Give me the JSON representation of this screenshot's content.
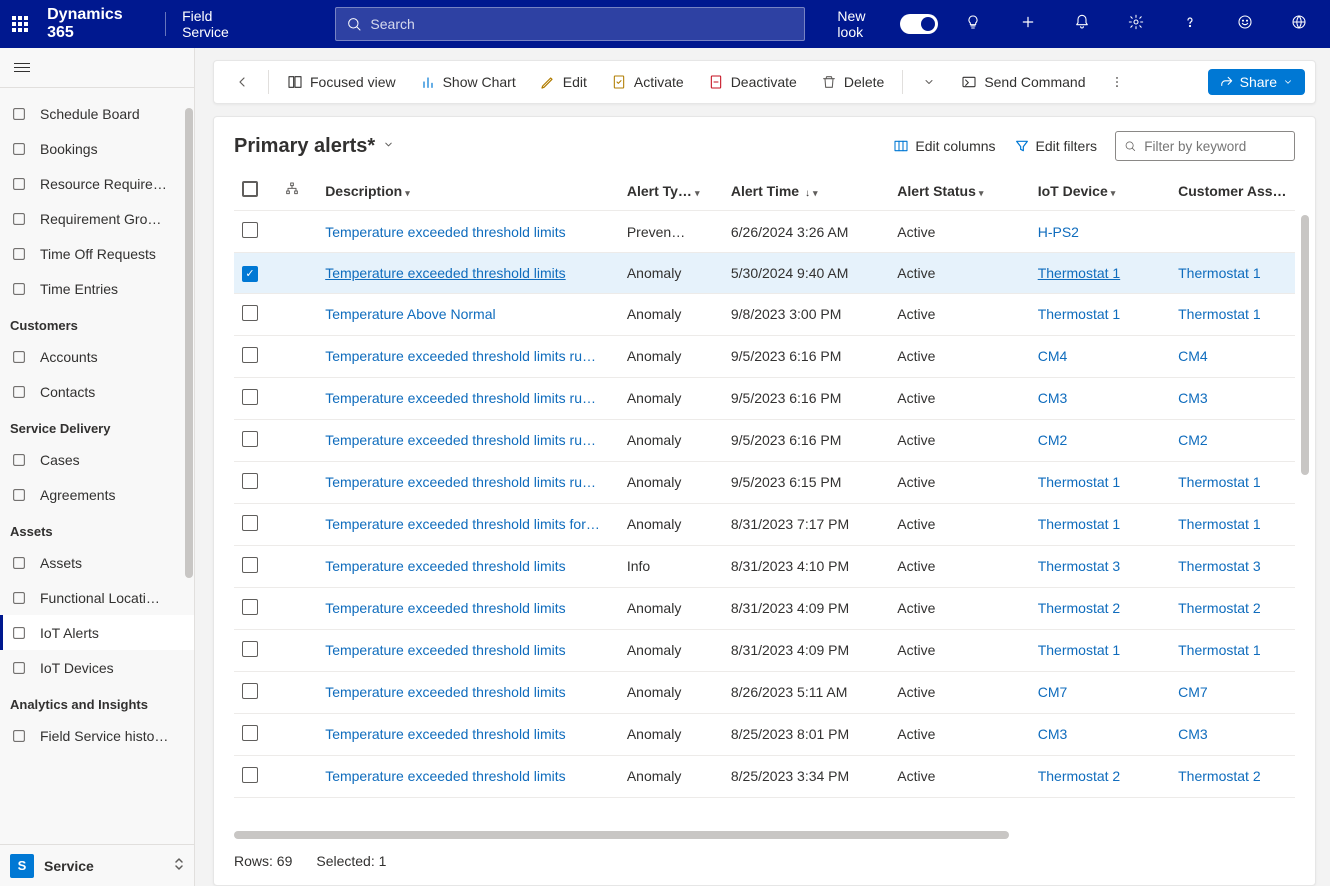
{
  "topbar": {
    "brand": "Dynamics 365",
    "area": "Field Service",
    "search_placeholder": "Search",
    "new_look": "New look"
  },
  "sidebar": {
    "items1": [
      {
        "icon": "calendar-board",
        "label": "Schedule Board"
      },
      {
        "icon": "people-queue",
        "label": "Bookings"
      },
      {
        "icon": "resource",
        "label": "Resource Require…"
      },
      {
        "icon": "group",
        "label": "Requirement Gro…"
      },
      {
        "icon": "timeoff",
        "label": "Time Off Requests"
      },
      {
        "icon": "calendar",
        "label": "Time Entries"
      }
    ],
    "section_customers": "Customers",
    "items2": [
      {
        "icon": "building",
        "label": "Accounts"
      },
      {
        "icon": "person",
        "label": "Contacts"
      }
    ],
    "section_service": "Service Delivery",
    "items3": [
      {
        "icon": "wrench",
        "label": "Cases"
      },
      {
        "icon": "doc",
        "label": "Agreements"
      }
    ],
    "section_assets": "Assets",
    "items4": [
      {
        "icon": "cube",
        "label": "Assets"
      },
      {
        "icon": "pin",
        "label": "Functional Locati…"
      },
      {
        "icon": "iot",
        "label": "IoT Alerts"
      },
      {
        "icon": "device",
        "label": "IoT Devices"
      }
    ],
    "section_analytics": "Analytics and Insights",
    "items5": [
      {
        "icon": "history",
        "label": "Field Service histo…"
      }
    ],
    "area_letter": "S",
    "area_label": "Service"
  },
  "cmdbar": {
    "focused_view": "Focused view",
    "show_chart": "Show Chart",
    "edit": "Edit",
    "activate": "Activate",
    "deactivate": "Deactivate",
    "delete": "Delete",
    "send_command": "Send Command",
    "share": "Share"
  },
  "panel": {
    "title": "Primary alerts*",
    "edit_columns": "Edit columns",
    "edit_filters": "Edit filters",
    "filter_placeholder": "Filter by keyword"
  },
  "columns": {
    "description": "Description",
    "alert_type": "Alert Ty…",
    "alert_time": "Alert Time",
    "alert_status": "Alert Status",
    "iot_device": "IoT Device",
    "customer_asset": "Customer Asset"
  },
  "rows": [
    {
      "sel": false,
      "desc": "Temperature exceeded threshold limits",
      "type": "Preven…",
      "time": "6/26/2024 3:26 AM",
      "status": "Active",
      "device": "H-PS2",
      "asset": ""
    },
    {
      "sel": true,
      "desc": "Temperature exceeded threshold limits",
      "type": "Anomaly",
      "time": "5/30/2024 9:40 AM",
      "status": "Active",
      "device": "Thermostat 1",
      "asset": "Thermostat 1"
    },
    {
      "sel": false,
      "desc": "Temperature Above Normal",
      "type": "Anomaly",
      "time": "9/8/2023 3:00 PM",
      "status": "Active",
      "device": "Thermostat 1",
      "asset": "Thermostat 1"
    },
    {
      "sel": false,
      "desc": "Temperature exceeded threshold limits ru…",
      "type": "Anomaly",
      "time": "9/5/2023 6:16 PM",
      "status": "Active",
      "device": "CM4",
      "asset": "CM4"
    },
    {
      "sel": false,
      "desc": "Temperature exceeded threshold limits ru…",
      "type": "Anomaly",
      "time": "9/5/2023 6:16 PM",
      "status": "Active",
      "device": "CM3",
      "asset": "CM3"
    },
    {
      "sel": false,
      "desc": "Temperature exceeded threshold limits ru…",
      "type": "Anomaly",
      "time": "9/5/2023 6:16 PM",
      "status": "Active",
      "device": "CM2",
      "asset": "CM2"
    },
    {
      "sel": false,
      "desc": "Temperature exceeded threshold limits ru…",
      "type": "Anomaly",
      "time": "9/5/2023 6:15 PM",
      "status": "Active",
      "device": "Thermostat 1",
      "asset": "Thermostat 1"
    },
    {
      "sel": false,
      "desc": "Temperature exceeded threshold limits for…",
      "type": "Anomaly",
      "time": "8/31/2023 7:17 PM",
      "status": "Active",
      "device": "Thermostat 1",
      "asset": "Thermostat 1"
    },
    {
      "sel": false,
      "desc": "Temperature exceeded threshold limits",
      "type": "Info",
      "time": "8/31/2023 4:10 PM",
      "status": "Active",
      "device": "Thermostat 3",
      "asset": "Thermostat 3"
    },
    {
      "sel": false,
      "desc": "Temperature exceeded threshold limits",
      "type": "Anomaly",
      "time": "8/31/2023 4:09 PM",
      "status": "Active",
      "device": "Thermostat 2",
      "asset": "Thermostat 2"
    },
    {
      "sel": false,
      "desc": "Temperature exceeded threshold limits",
      "type": "Anomaly",
      "time": "8/31/2023 4:09 PM",
      "status": "Active",
      "device": "Thermostat 1",
      "asset": "Thermostat 1"
    },
    {
      "sel": false,
      "desc": "Temperature exceeded threshold limits",
      "type": "Anomaly",
      "time": "8/26/2023 5:11 AM",
      "status": "Active",
      "device": "CM7",
      "asset": "CM7"
    },
    {
      "sel": false,
      "desc": "Temperature exceeded threshold limits",
      "type": "Anomaly",
      "time": "8/25/2023 8:01 PM",
      "status": "Active",
      "device": "CM3",
      "asset": "CM3"
    },
    {
      "sel": false,
      "desc": "Temperature exceeded threshold limits",
      "type": "Anomaly",
      "time": "8/25/2023 3:34 PM",
      "status": "Active",
      "device": "Thermostat 2",
      "asset": "Thermostat 2"
    }
  ],
  "footer": {
    "rows": "Rows: 69",
    "selected": "Selected: 1"
  }
}
